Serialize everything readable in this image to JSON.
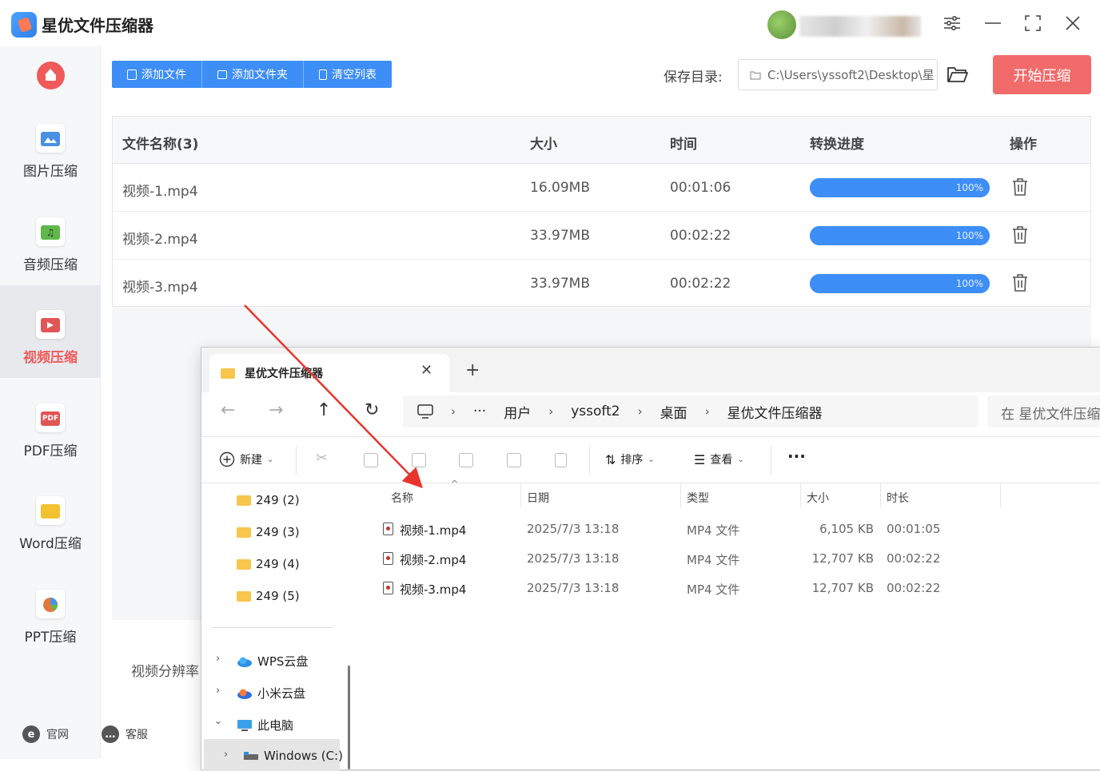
{
  "app": {
    "title": "星优文件压缩器"
  },
  "sidebar": {
    "items": [
      {
        "label": "图片压缩",
        "icon": "image-icon",
        "color": "#4a90e2"
      },
      {
        "label": "音频压缩",
        "icon": "audio-icon",
        "color": "#5fb84a"
      },
      {
        "label": "视频压缩",
        "icon": "video-icon",
        "color": "#e05555",
        "active": true
      },
      {
        "label": "PDF压缩",
        "icon": "pdf-icon",
        "color": "#e05555",
        "text": "PDF"
      },
      {
        "label": "Word压缩",
        "icon": "word-icon",
        "color": "#f2c230"
      },
      {
        "label": "PPT压缩",
        "icon": "ppt-icon",
        "color": "#e07a3c"
      }
    ],
    "footer": {
      "website": "官网",
      "support": "客服"
    }
  },
  "toolbar": {
    "add_file": "添加文件",
    "add_folder": "添加文件夹",
    "clear_list": "清空列表",
    "save_label": "保存目录:",
    "save_path": "C:\\Users\\yssoft2\\Desktop\\星",
    "start_label": "开始压缩",
    "accent": "#3d8ef7",
    "start_color": "#f16b6b"
  },
  "table": {
    "headers": {
      "name": "文件名称(3)",
      "size": "大小",
      "time": "时间",
      "progress": "转换进度",
      "action": "操作"
    },
    "rows": [
      {
        "name": "视频-1.mp4",
        "size": "16.09MB",
        "time": "00:01:06",
        "progress": 100,
        "progress_text": "100%"
      },
      {
        "name": "视频-2.mp4",
        "size": "33.97MB",
        "time": "00:02:22",
        "progress": 100,
        "progress_text": "100%"
      },
      {
        "name": "视频-3.mp4",
        "size": "33.97MB",
        "time": "00:02:22",
        "progress": 100,
        "progress_text": "100%"
      }
    ]
  },
  "settings": {
    "resolution_label": "视频分辨率"
  },
  "explorer": {
    "tab_title": "星优文件压缩器",
    "breadcrumb": [
      "用户",
      "yssoft2",
      "桌面",
      "星优文件压缩器"
    ],
    "search_placeholder": "在 星优文件压缩器",
    "commands": {
      "new": "新建",
      "sort": "排序",
      "view": "查看"
    },
    "tree": {
      "folders": [
        "249 (2)",
        "249 (3)",
        "249 (4)",
        "249 (5)"
      ],
      "locations": [
        "WPS云盘",
        "小米云盘",
        "此电脑",
        "Windows (C:)"
      ]
    },
    "columns": {
      "name": "名称",
      "date": "日期",
      "type": "类型",
      "size": "大小",
      "duration": "时长"
    },
    "files": [
      {
        "name": "视频-1.mp4",
        "date": "2025/7/3 13:18",
        "type": "MP4 文件",
        "size": "6,105 KB",
        "duration": "00:01:05"
      },
      {
        "name": "视频-2.mp4",
        "date": "2025/7/3 13:18",
        "type": "MP4 文件",
        "size": "12,707 KB",
        "duration": "00:02:22"
      },
      {
        "name": "视频-3.mp4",
        "date": "2025/7/3 13:18",
        "type": "MP4 文件",
        "size": "12,707 KB",
        "duration": "00:02:22"
      }
    ]
  }
}
